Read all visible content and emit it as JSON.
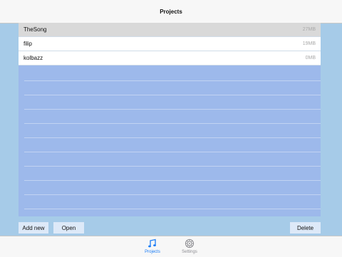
{
  "navbar": {
    "title": "Projects"
  },
  "projects": [
    {
      "name": "TheSong",
      "size": "27MB",
      "selected": true
    },
    {
      "name": "filip",
      "size": "19MB",
      "selected": false
    },
    {
      "name": "kolbazz",
      "size": "0MB",
      "selected": false
    }
  ],
  "toolbar": {
    "add_new_label": "Add new",
    "open_label": "Open",
    "delete_label": "Delete"
  },
  "tabs": [
    {
      "label": "Projects",
      "icon": "music-note-icon",
      "active": true
    },
    {
      "label": "Settings",
      "icon": "gear-icon",
      "active": false
    }
  ],
  "colors": {
    "accent": "#1a7cf6",
    "background": "#a6cbe8",
    "list_background": "#9db9eb",
    "selected_row": "#d9d9d9",
    "button_background": "#dde9f8"
  }
}
